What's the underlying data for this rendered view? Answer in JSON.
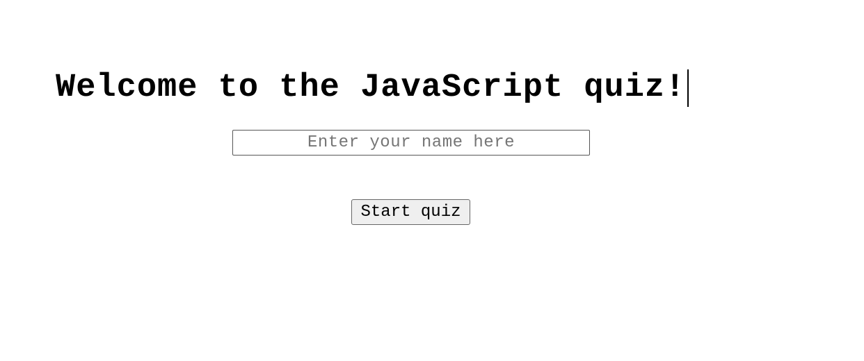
{
  "page": {
    "title": "Welcome to the JavaScript quiz!"
  },
  "form": {
    "name_placeholder": "Enter your name here",
    "name_value": "",
    "start_label": "Start quiz"
  }
}
